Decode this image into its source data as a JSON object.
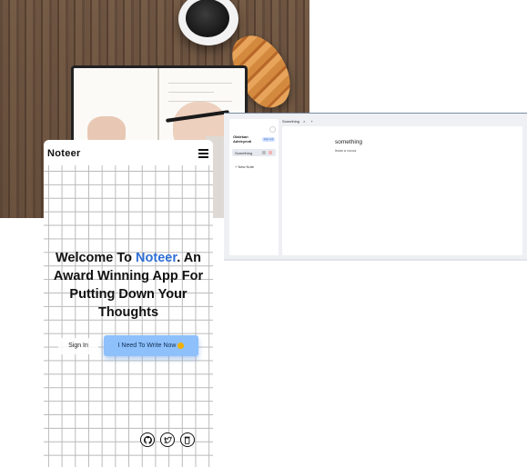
{
  "mobile": {
    "brand": "Noteer",
    "headline_prefix": "Welcome To ",
    "headline_brand": "Noteer",
    "headline_suffix": ". An Award Winning App For Putting Down Your Thoughts",
    "signin_label": "Sign In",
    "cta_label": "I Need To Write Now",
    "social_icons": [
      "github-icon",
      "twitter-icon",
      "coffee-icon"
    ],
    "accent_color": "#2f6fd6",
    "cta_color": "#8ec0fb"
  },
  "desktop": {
    "user_name_line1": "Olalekan",
    "user_name_line2": "Adeleyeoti",
    "pill_label": "sign out",
    "notes": [
      {
        "title": "Something"
      }
    ],
    "new_note_label": "+   New Note",
    "tab_label": "Something",
    "tab_close": "×",
    "tab_add": "+",
    "doc_title": "something",
    "doc_body": "Itwas a cocoa"
  }
}
